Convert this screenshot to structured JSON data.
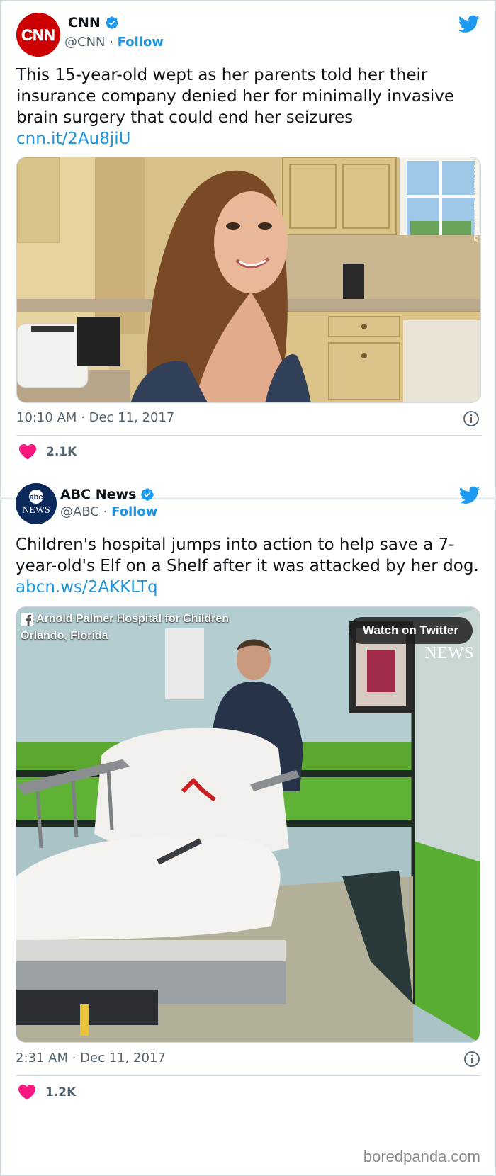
{
  "tweets": [
    {
      "author": {
        "name": "CNN",
        "handle": "@CNN",
        "follow_label": "Follow",
        "avatar_text": "CNN"
      },
      "text": "This 15-year-old wept as her parents told her their insurance company denied her for minimally invasive brain surgery that could end her seizures",
      "link": "cnn.it/2Au8jiU",
      "media": {
        "credit": "COURTESY: FREEDMAN FAMILY"
      },
      "timestamp": "10:10 AM · Dec 11, 2017",
      "likes": "2.1K"
    },
    {
      "author": {
        "name": "ABC News",
        "handle": "@ABC",
        "follow_label": "Follow",
        "avatar_top": "abc",
        "avatar_bottom": "NEWS"
      },
      "text": "Children's hospital jumps into action to help save a 7-year-old's Elf on a Shelf after it was attacked by her dog.",
      "link": "abcn.ws/2AKKLTq",
      "media": {
        "source_line1": "Arnold Palmer Hospital for Children",
        "source_line2": "Orlando, Florida",
        "watch_label": "Watch on Twitter",
        "bug": "NEWS"
      },
      "timestamp": "2:31 AM · Dec 11, 2017",
      "likes": "1.2K"
    }
  ],
  "watermark": "boredpanda.com",
  "colors": {
    "link": "#1b95e0",
    "heart": "#f91880",
    "cnn_red": "#cc0000",
    "abc_navy": "#0b2a5b"
  },
  "icons": [
    "verified-badge-icon",
    "twitter-bird-icon",
    "info-icon",
    "heart-icon",
    "facebook-icon"
  ]
}
